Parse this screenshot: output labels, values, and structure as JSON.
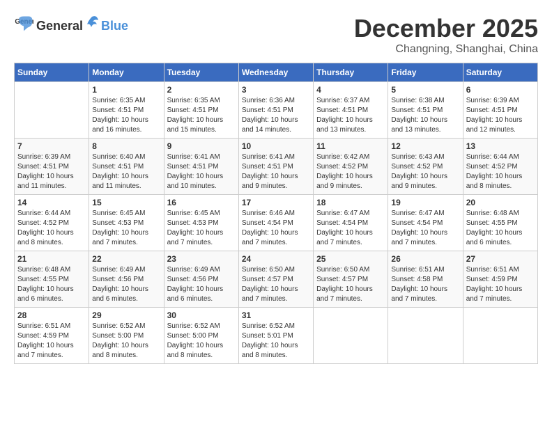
{
  "logo": {
    "general": "General",
    "blue": "Blue"
  },
  "title": "December 2025",
  "subtitle": "Changning, Shanghai, China",
  "days_header": [
    "Sunday",
    "Monday",
    "Tuesday",
    "Wednesday",
    "Thursday",
    "Friday",
    "Saturday"
  ],
  "weeks": [
    [
      {
        "day": "",
        "info": ""
      },
      {
        "day": "1",
        "info": "Sunrise: 6:35 AM\nSunset: 4:51 PM\nDaylight: 10 hours\nand 16 minutes."
      },
      {
        "day": "2",
        "info": "Sunrise: 6:35 AM\nSunset: 4:51 PM\nDaylight: 10 hours\nand 15 minutes."
      },
      {
        "day": "3",
        "info": "Sunrise: 6:36 AM\nSunset: 4:51 PM\nDaylight: 10 hours\nand 14 minutes."
      },
      {
        "day": "4",
        "info": "Sunrise: 6:37 AM\nSunset: 4:51 PM\nDaylight: 10 hours\nand 13 minutes."
      },
      {
        "day": "5",
        "info": "Sunrise: 6:38 AM\nSunset: 4:51 PM\nDaylight: 10 hours\nand 13 minutes."
      },
      {
        "day": "6",
        "info": "Sunrise: 6:39 AM\nSunset: 4:51 PM\nDaylight: 10 hours\nand 12 minutes."
      }
    ],
    [
      {
        "day": "7",
        "info": "Sunrise: 6:39 AM\nSunset: 4:51 PM\nDaylight: 10 hours\nand 11 minutes."
      },
      {
        "day": "8",
        "info": "Sunrise: 6:40 AM\nSunset: 4:51 PM\nDaylight: 10 hours\nand 11 minutes."
      },
      {
        "day": "9",
        "info": "Sunrise: 6:41 AM\nSunset: 4:51 PM\nDaylight: 10 hours\nand 10 minutes."
      },
      {
        "day": "10",
        "info": "Sunrise: 6:41 AM\nSunset: 4:51 PM\nDaylight: 10 hours\nand 9 minutes."
      },
      {
        "day": "11",
        "info": "Sunrise: 6:42 AM\nSunset: 4:52 PM\nDaylight: 10 hours\nand 9 minutes."
      },
      {
        "day": "12",
        "info": "Sunrise: 6:43 AM\nSunset: 4:52 PM\nDaylight: 10 hours\nand 9 minutes."
      },
      {
        "day": "13",
        "info": "Sunrise: 6:44 AM\nSunset: 4:52 PM\nDaylight: 10 hours\nand 8 minutes."
      }
    ],
    [
      {
        "day": "14",
        "info": "Sunrise: 6:44 AM\nSunset: 4:52 PM\nDaylight: 10 hours\nand 8 minutes."
      },
      {
        "day": "15",
        "info": "Sunrise: 6:45 AM\nSunset: 4:53 PM\nDaylight: 10 hours\nand 7 minutes."
      },
      {
        "day": "16",
        "info": "Sunrise: 6:45 AM\nSunset: 4:53 PM\nDaylight: 10 hours\nand 7 minutes."
      },
      {
        "day": "17",
        "info": "Sunrise: 6:46 AM\nSunset: 4:54 PM\nDaylight: 10 hours\nand 7 minutes."
      },
      {
        "day": "18",
        "info": "Sunrise: 6:47 AM\nSunset: 4:54 PM\nDaylight: 10 hours\nand 7 minutes."
      },
      {
        "day": "19",
        "info": "Sunrise: 6:47 AM\nSunset: 4:54 PM\nDaylight: 10 hours\nand 7 minutes."
      },
      {
        "day": "20",
        "info": "Sunrise: 6:48 AM\nSunset: 4:55 PM\nDaylight: 10 hours\nand 6 minutes."
      }
    ],
    [
      {
        "day": "21",
        "info": "Sunrise: 6:48 AM\nSunset: 4:55 PM\nDaylight: 10 hours\nand 6 minutes."
      },
      {
        "day": "22",
        "info": "Sunrise: 6:49 AM\nSunset: 4:56 PM\nDaylight: 10 hours\nand 6 minutes."
      },
      {
        "day": "23",
        "info": "Sunrise: 6:49 AM\nSunset: 4:56 PM\nDaylight: 10 hours\nand 6 minutes."
      },
      {
        "day": "24",
        "info": "Sunrise: 6:50 AM\nSunset: 4:57 PM\nDaylight: 10 hours\nand 7 minutes."
      },
      {
        "day": "25",
        "info": "Sunrise: 6:50 AM\nSunset: 4:57 PM\nDaylight: 10 hours\nand 7 minutes."
      },
      {
        "day": "26",
        "info": "Sunrise: 6:51 AM\nSunset: 4:58 PM\nDaylight: 10 hours\nand 7 minutes."
      },
      {
        "day": "27",
        "info": "Sunrise: 6:51 AM\nSunset: 4:59 PM\nDaylight: 10 hours\nand 7 minutes."
      }
    ],
    [
      {
        "day": "28",
        "info": "Sunrise: 6:51 AM\nSunset: 4:59 PM\nDaylight: 10 hours\nand 7 minutes."
      },
      {
        "day": "29",
        "info": "Sunrise: 6:52 AM\nSunset: 5:00 PM\nDaylight: 10 hours\nand 8 minutes."
      },
      {
        "day": "30",
        "info": "Sunrise: 6:52 AM\nSunset: 5:00 PM\nDaylight: 10 hours\nand 8 minutes."
      },
      {
        "day": "31",
        "info": "Sunrise: 6:52 AM\nSunset: 5:01 PM\nDaylight: 10 hours\nand 8 minutes."
      },
      {
        "day": "",
        "info": ""
      },
      {
        "day": "",
        "info": ""
      },
      {
        "day": "",
        "info": ""
      }
    ]
  ]
}
